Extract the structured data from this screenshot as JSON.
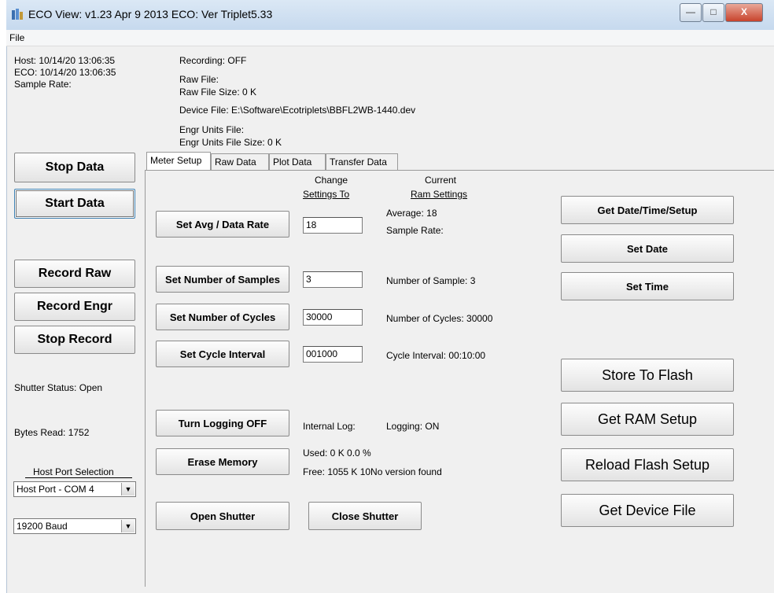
{
  "window": {
    "title": "ECO View:  v1.23 Apr  9 2013 ECO: Ver Triplet5.33",
    "minimize_glyph": "—",
    "maximize_glyph": "□",
    "close_glyph": "X"
  },
  "menu": {
    "file": "File"
  },
  "status": {
    "host": "Host:  10/14/20 13:06:35",
    "eco": "ECO:   10/14/20 13:06:35",
    "sample_rate": "Sample Rate:",
    "recording": "Recording:  OFF",
    "raw_file": "Raw File:",
    "raw_file_size": "Raw File Size: 0 K",
    "device_file": "Device File:  E:\\Software\\Ecotriplets\\BBFL2WB-1440.dev",
    "engr_units_file": "Engr Units File:",
    "engr_units_file_size": "Engr Units File Size: 0 K"
  },
  "left": {
    "stop_data": "Stop Data",
    "start_data": "Start Data",
    "record_raw": "Record  Raw",
    "record_engr": "Record Engr",
    "stop_record": "Stop Record",
    "shutter_status": "Shutter Status: Open",
    "bytes_read": "Bytes Read: 1752",
    "host_port_label": "Host Port Selection",
    "host_port_value": "Host Port - COM 4",
    "baud_value": "19200 Baud"
  },
  "tabs": [
    "Meter Setup",
    "Raw Data",
    "Plot Data",
    "Transfer Data"
  ],
  "meter": {
    "change_header_1": "Change",
    "change_header_2": "Settings To",
    "current_header_1": "Current",
    "current_header_2": "Ram Settings",
    "set_avg_btn": "Set Avg / Data Rate",
    "avg_value": "18",
    "avg_current": "Average: 18",
    "sample_rate_current": "Sample Rate:",
    "set_samples_btn": "Set Number of Samples",
    "samples_value": "3",
    "samples_current": "Number of Sample: 3",
    "set_cycles_btn": "Set Number of Cycles",
    "cycles_value": "30000",
    "cycles_current": "Number of Cycles: 30000",
    "set_interval_btn": "Set Cycle Interval",
    "interval_value": "001000",
    "interval_current": "Cycle Interval: 00:10:00",
    "logging_btn": "Turn Logging OFF",
    "internal_log": "Internal Log:",
    "logging_status": "Logging: ON",
    "erase_btn": "Erase Memory",
    "used": "Used:  0 K  0.0 %",
    "free": "Free:  1055 K  10No version found",
    "open_shutter": "Open Shutter",
    "close_shutter": "Close Shutter",
    "get_date_time": "Get Date/Time/Setup",
    "set_date": "Set Date",
    "set_time": "Set Time",
    "store_flash": "Store To Flash",
    "get_ram": "Get RAM Setup",
    "reload_flash": "Reload Flash Setup",
    "get_device": "Get Device File"
  }
}
